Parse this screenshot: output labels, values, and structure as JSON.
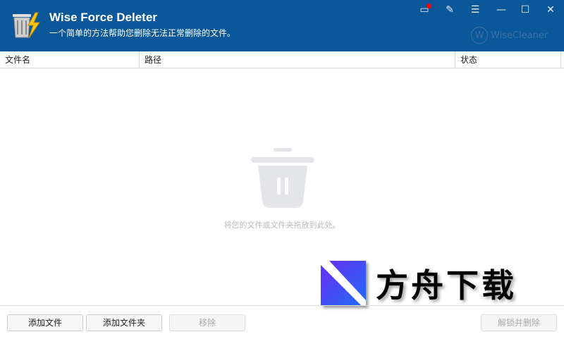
{
  "app": {
    "title": "Wise Force Deleter",
    "subtitle": "一个简单的方法帮助您删除无法正常删除的文件。",
    "brand": "WiseCleaner",
    "brand_mark": "W"
  },
  "window_controls": [
    "feedback",
    "edit",
    "menu",
    "minimize",
    "maximize",
    "close"
  ],
  "columns": [
    "文件名",
    "路径",
    "状态"
  ],
  "empty_state": {
    "text": "将您的文件或文件夹拖放到此处。"
  },
  "buttons": {
    "add_file": "添加文件",
    "add_folder": "添加文件夹",
    "remove": "移除",
    "unlock_delete": "解锁并删除"
  },
  "watermark": {
    "text": "方舟下载"
  },
  "colors": {
    "header": "#0a5799",
    "badge": "#ff0000"
  }
}
